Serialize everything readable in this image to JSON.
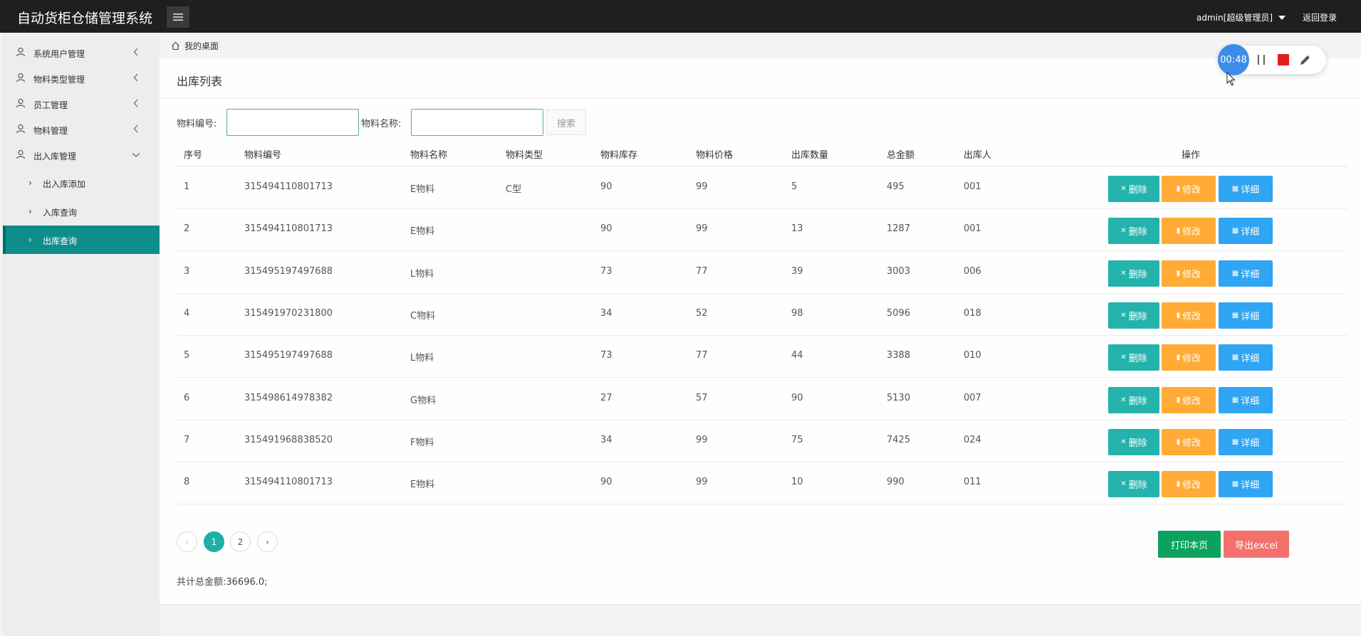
{
  "app": {
    "title": "自动货柜仓储管理系统"
  },
  "header": {
    "user": "admin[超级管理员]",
    "logout": "返回登录"
  },
  "sidebar": {
    "items": [
      {
        "label": "系统用户管理",
        "expanded": false
      },
      {
        "label": "物料类型管理",
        "expanded": false
      },
      {
        "label": "员工管理",
        "expanded": false
      },
      {
        "label": "物料管理",
        "expanded": false
      },
      {
        "label": "出入库管理",
        "expanded": true
      }
    ],
    "subitems": [
      {
        "label": "出入库添加",
        "active": false
      },
      {
        "label": "入库查询",
        "active": false
      },
      {
        "label": "出库查询",
        "active": true
      }
    ]
  },
  "breadcrumb": {
    "home": "我的桌面"
  },
  "main": {
    "title": "出库列表",
    "search": {
      "code_label": "物料编号:",
      "code_value": "",
      "name_label": "物料名称:",
      "name_value": "",
      "button": "搜索"
    },
    "table": {
      "headers": [
        "序号",
        "物料编号",
        "物料名称",
        "物料类型",
        "物料库存",
        "物料价格",
        "出库数量",
        "总金额",
        "出库人",
        "操作"
      ],
      "rows": [
        [
          "1",
          "315494110801713",
          "E物料",
          "C型",
          "90",
          "99",
          "5",
          "495",
          "001"
        ],
        [
          "2",
          "315494110801713",
          "E物料",
          "",
          "90",
          "99",
          "13",
          "1287",
          "001"
        ],
        [
          "3",
          "315495197497688",
          "L物料",
          "",
          "73",
          "77",
          "39",
          "3003",
          "006"
        ],
        [
          "4",
          "315491970231800",
          "C物料",
          "",
          "34",
          "52",
          "98",
          "5096",
          "018"
        ],
        [
          "5",
          "315495197497688",
          "L物料",
          "",
          "73",
          "77",
          "44",
          "3388",
          "010"
        ],
        [
          "6",
          "315498614978382",
          "G物料",
          "",
          "27",
          "57",
          "90",
          "5130",
          "007"
        ],
        [
          "7",
          "315491968838520",
          "F物料",
          "",
          "34",
          "99",
          "75",
          "7425",
          "024"
        ],
        [
          "8",
          "315494110801713",
          "E物料",
          "",
          "90",
          "99",
          "10",
          "990",
          "011"
        ]
      ],
      "actions": {
        "delete": "删除",
        "edit": "修改",
        "detail": "详细"
      }
    },
    "pagination": {
      "pages": [
        "1",
        "2"
      ],
      "current": "1",
      "prev": "‹",
      "next": "›"
    },
    "print_button": "打印本页",
    "export_button": "导出excel",
    "total": "共计总金额:36696.0;"
  },
  "recorder": {
    "time": "00:48"
  },
  "colors": {
    "topbar": "#1f1f1f",
    "active_menu": "#0e8e8a",
    "delete": "#23b3ac",
    "edit": "#ffab36",
    "detail": "#2fa5f3",
    "print": "#0aa25e",
    "export": "#f3706b"
  }
}
